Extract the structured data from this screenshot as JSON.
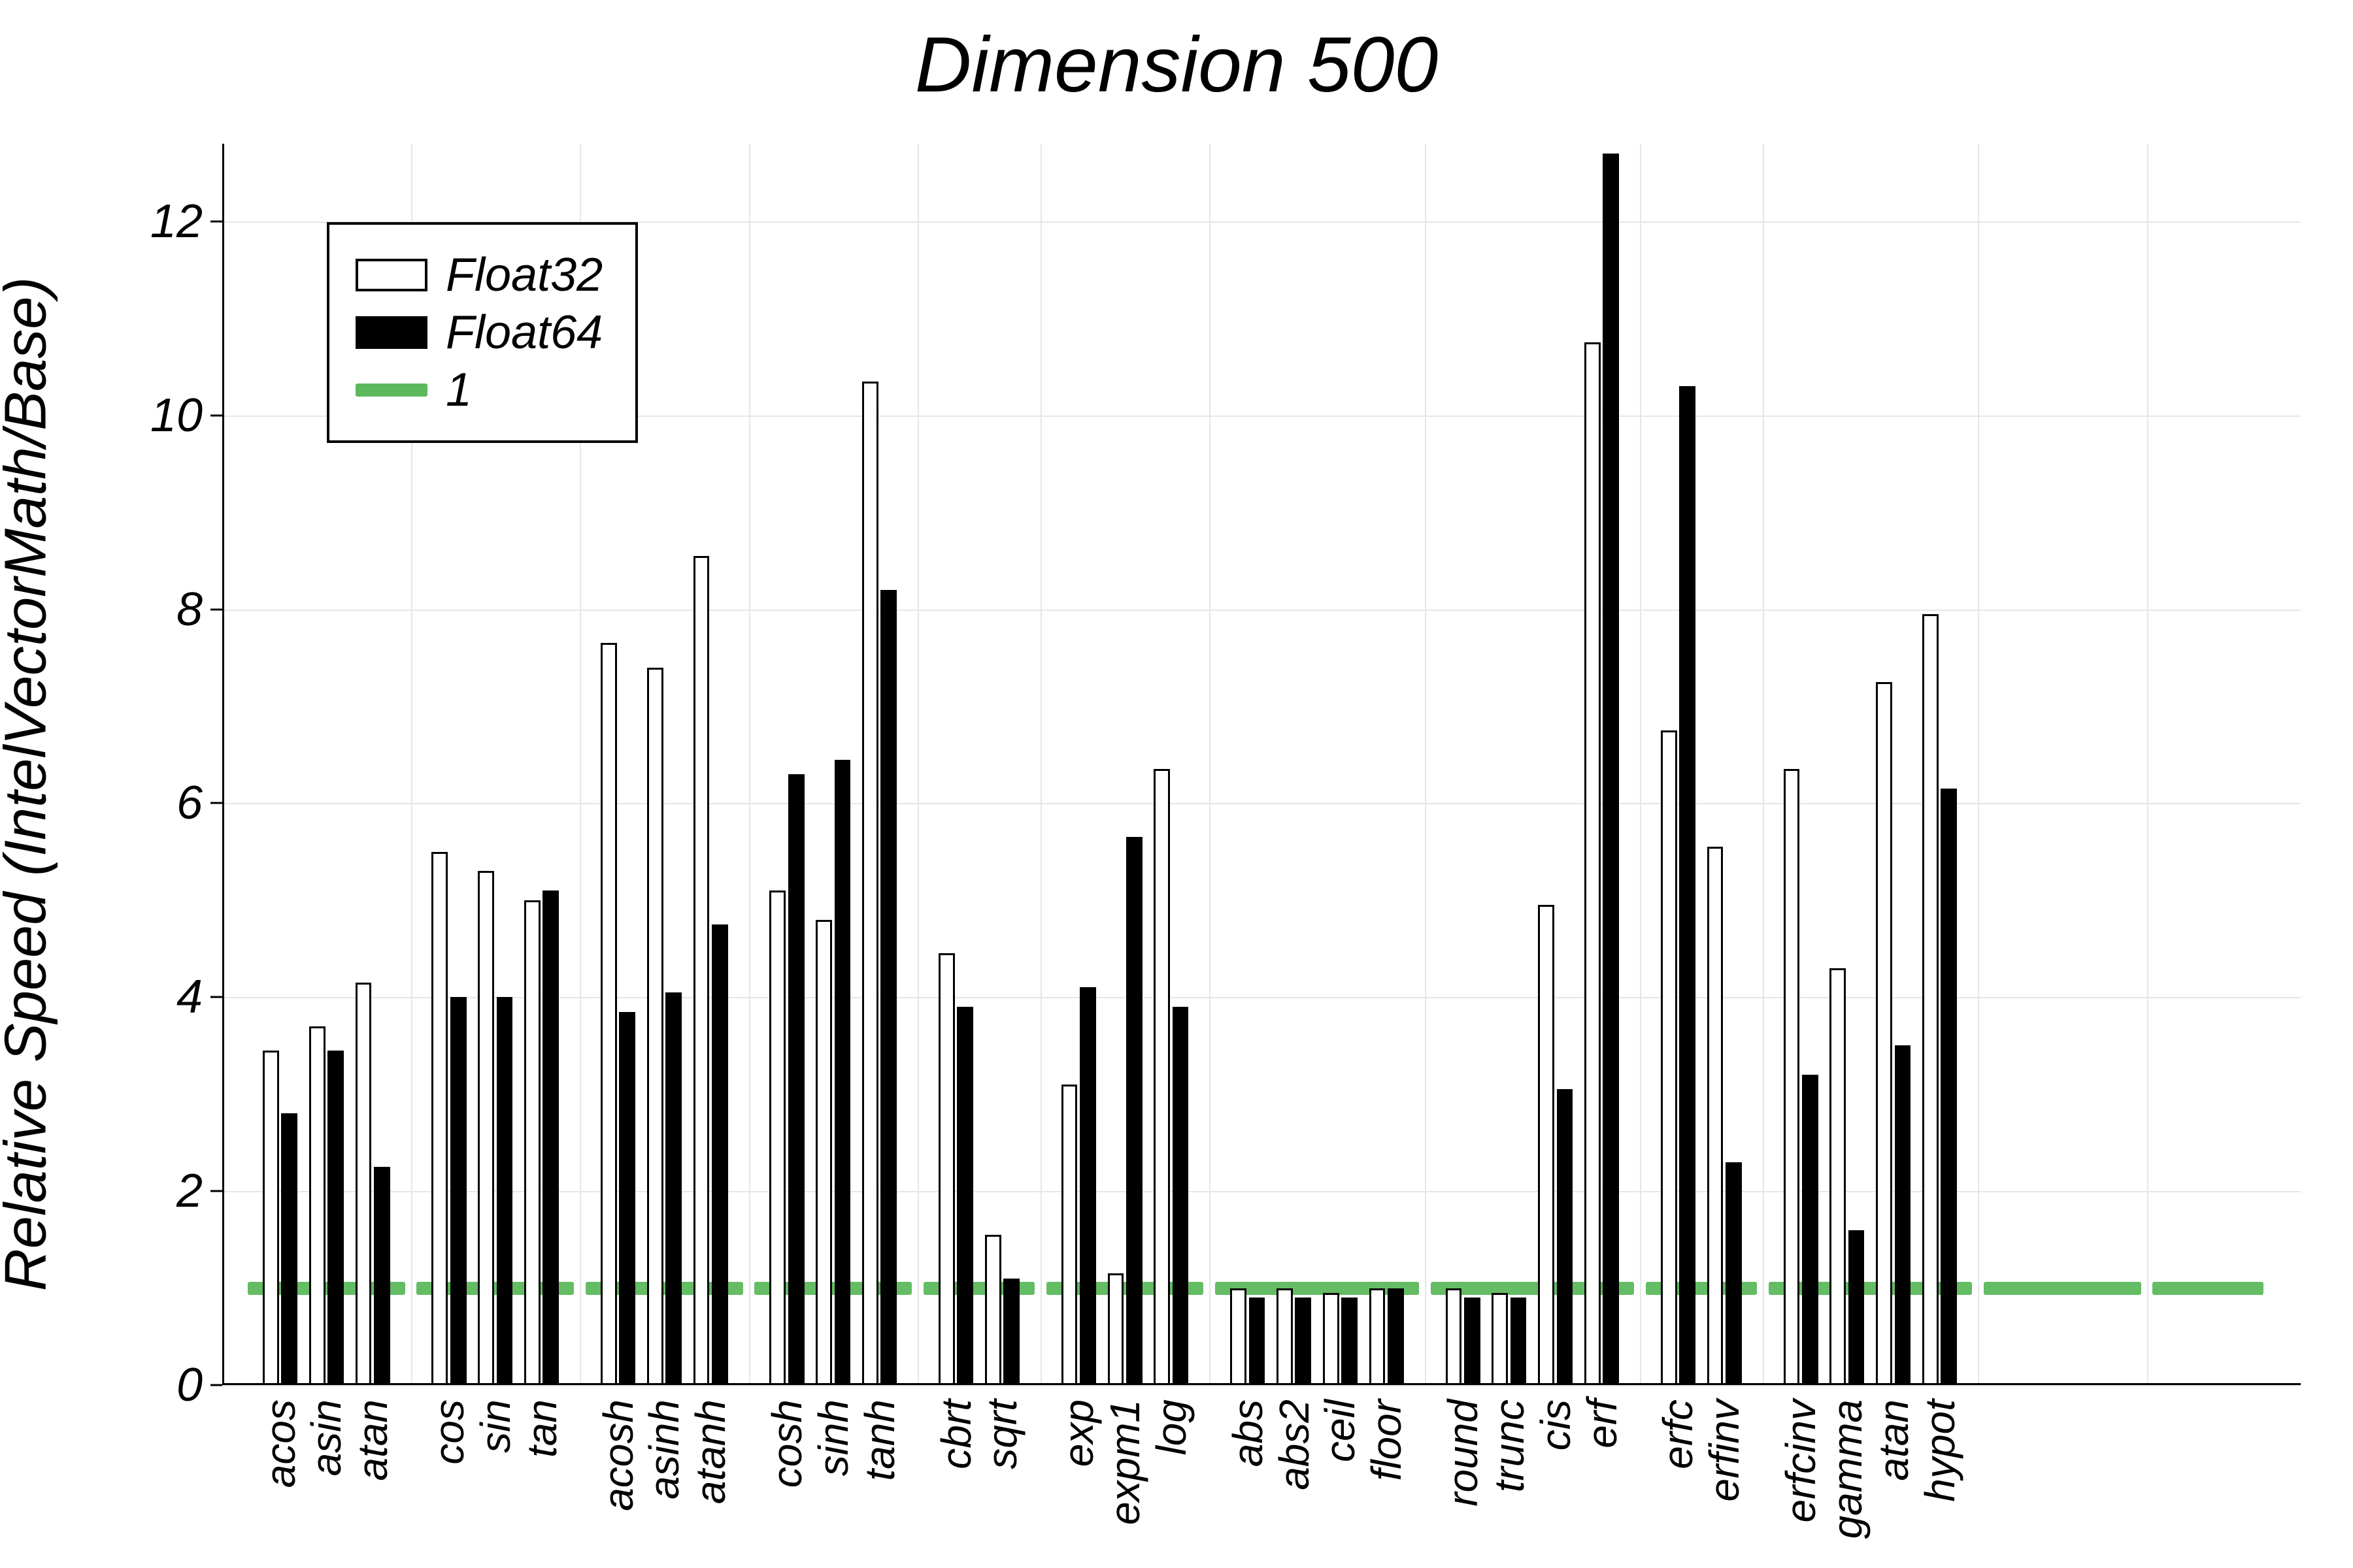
{
  "chart_data": {
    "type": "bar",
    "title": "Dimension 500",
    "ylabel": "Relative Speed (IntelVectorMath/Base)",
    "xlabel": "",
    "ylim": [
      0,
      12.8
    ],
    "yticks": [
      0,
      2,
      4,
      6,
      8,
      10,
      12
    ],
    "categories": [
      "acos",
      "asin",
      "atan",
      "cos",
      "sin",
      "tan",
      "acosh",
      "asinh",
      "atanh",
      "cosh",
      "sinh",
      "tanh",
      "cbrt",
      "sqrt",
      "exp",
      "expm1",
      "log",
      "abs",
      "abs2",
      "ceil",
      "floor",
      "round",
      "trunc",
      "cis",
      "erf",
      "erfc",
      "erfinv",
      "erfcinv",
      "gamma",
      "atan",
      "hypot"
    ],
    "series": [
      {
        "name": "Float32",
        "color": "#ffffff",
        "border": "#000000",
        "values": [
          3.45,
          3.7,
          4.15,
          5.5,
          5.3,
          5.0,
          7.65,
          7.4,
          8.55,
          5.1,
          4.8,
          10.35,
          4.45,
          1.55,
          3.1,
          1.15,
          6.35,
          1.0,
          1.0,
          0.95,
          1.0,
          1.0,
          0.95,
          4.95,
          10.75,
          6.75,
          5.55,
          6.35,
          4.3,
          7.25,
          7.95
        ]
      },
      {
        "name": "Float64",
        "color": "#000000",
        "values": [
          2.8,
          3.45,
          2.25,
          4.0,
          4.0,
          5.1,
          3.85,
          4.05,
          4.75,
          6.3,
          6.45,
          8.2,
          3.9,
          1.1,
          4.1,
          5.65,
          3.9,
          0.9,
          0.9,
          0.9,
          1.0,
          0.9,
          0.9,
          3.05,
          12.7,
          10.3,
          2.3,
          3.2,
          1.6,
          3.5,
          6.15
        ]
      }
    ],
    "reference_line": {
      "label": "1",
      "value": 1,
      "color": "#5cb85c"
    },
    "group_sizes": [
      3,
      3,
      3,
      3,
      2,
      3,
      4,
      4,
      2,
      4,
      3,
      2
    ],
    "legend": [
      "Float32",
      "Float64",
      "1"
    ]
  }
}
